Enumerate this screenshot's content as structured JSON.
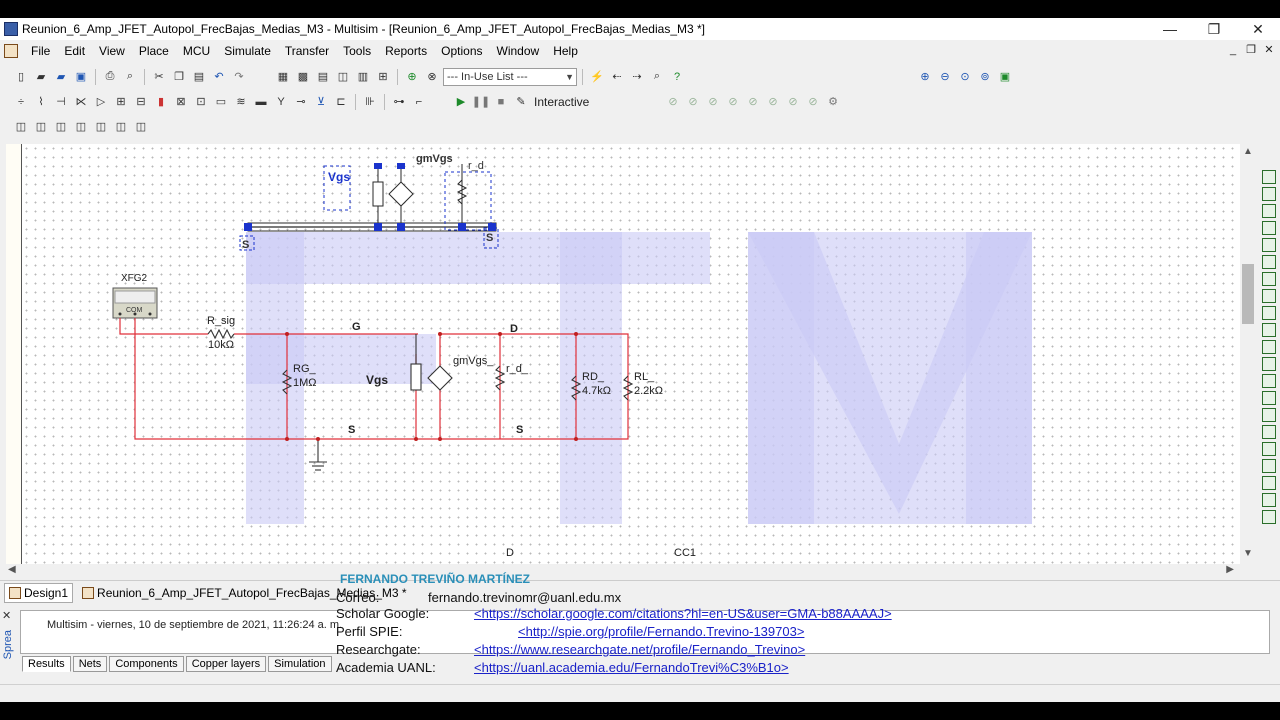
{
  "window": {
    "title": "Reunion_6_Amp_JFET_Autopol_FrecBajas_Medias_M3 - Multisim - [Reunion_6_Amp_JFET_Autopol_FrecBajas_Medias_M3 *]",
    "minimize": "—",
    "restore": "❐",
    "close": "✕"
  },
  "menu": {
    "items": [
      "File",
      "Edit",
      "View",
      "Place",
      "MCU",
      "Simulate",
      "Transfer",
      "Tools",
      "Reports",
      "Options",
      "Window",
      "Help"
    ]
  },
  "toolbar": {
    "in_use_list": "--- In-Use List ---",
    "interactive": "Interactive"
  },
  "schematic": {
    "top": {
      "vgs": "Vgs",
      "gmvgs": "gmVgs",
      "rd": "r_d",
      "s_left": "S",
      "s_right": "S"
    },
    "xfg": {
      "name": "XFG2",
      "com": "COM"
    },
    "r_sig": {
      "name": "R_sig",
      "value": "10kΩ"
    },
    "rg": {
      "name": "RG_",
      "value": "1MΩ"
    },
    "node_g": "G",
    "node_d": "D",
    "vgs": "Vgs",
    "gmvgs": "gmVgs_",
    "rd_small": "r_d_",
    "rd_big": {
      "name": "RD_",
      "value": "4.7kΩ"
    },
    "rl": {
      "name": "RL_",
      "value": "2.2kΩ"
    },
    "s_left": "S",
    "s_right": "S",
    "bottom_d": "D",
    "bottom_cc": "CC1"
  },
  "tabs": {
    "design": "Design1",
    "file": "Reunion_6_Amp_JFET_Autopol_FrecBajas_Medias_M3 *"
  },
  "spreadsheet": {
    "side_label": "Sprea",
    "log": "Multisim  -  viernes, 10 de septiembre de 2021, 11:26:24 a. m.",
    "tabs": [
      "Results",
      "Nets",
      "Components",
      "Copper layers",
      "Simulation"
    ]
  },
  "credits": {
    "name": "FERNANDO TREVIÑO MARTÍNEZ",
    "correo_label": "Correo:",
    "correo": "fernando.trevinomr@uanl.edu.mx",
    "scholar_label": "Scholar Google:",
    "scholar": "<https://scholar.google.com/citations?hl=en-US&user=GMA-b88AAAAJ>",
    "spie_label": "Perfil SPIE:",
    "spie": "<http://spie.org/profile/Fernando.Trevino-139703>",
    "rg_label": "Researchgate:",
    "rg": "<https://www.researchgate.net/profile/Fernando_Trevino>",
    "uanl_label": "Academia UANL:",
    "uanl": "<https://uanl.academia.edu/FernandoTrevi%C3%B1o>"
  },
  "colors": {
    "wire_red": "#e0303a",
    "component_dark": "#333333",
    "selection_blue": "#1a33cc",
    "watermark": "#c9c9f5",
    "link": "#1a22c8",
    "name_teal": "#2a8fb8"
  },
  "watermark_letters": "FTM"
}
